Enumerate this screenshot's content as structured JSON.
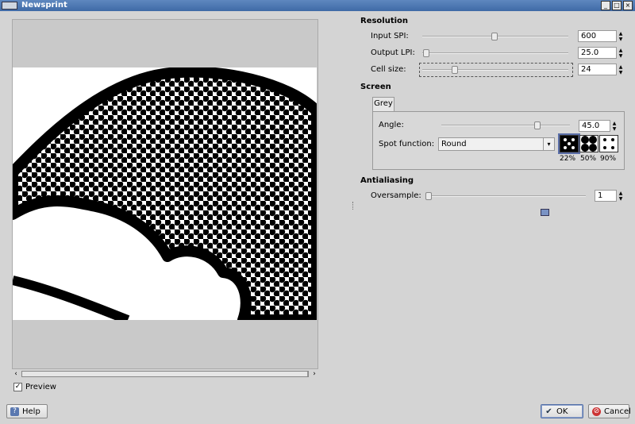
{
  "window": {
    "title": "Newsprint",
    "buttons": [
      "_",
      "□",
      "×"
    ]
  },
  "preview": {
    "checkbox_label": "Preview",
    "checked": true
  },
  "resolution": {
    "heading": "Resolution",
    "input_spi": {
      "label": "Input SPI:",
      "value": "600"
    },
    "output_lpi": {
      "label": "Output LPI:",
      "value": "25.0"
    },
    "cell_size": {
      "label": "Cell size:",
      "value": "24"
    }
  },
  "screen": {
    "heading": "Screen",
    "tab": "Grey",
    "angle": {
      "label": "Angle:",
      "value": "45.0"
    },
    "spot_function": {
      "label": "Spot function:",
      "value": "Round"
    },
    "spot_previews": [
      "22%",
      "50%",
      "90%"
    ]
  },
  "antialiasing": {
    "heading": "Antialiasing",
    "oversample": {
      "label": "Oversample:",
      "value": "1"
    }
  },
  "footer": {
    "help": "Help",
    "ok": "OK",
    "cancel": "Cancel"
  },
  "icons": {
    "help": "help-icon",
    "ok": "checkmark-icon",
    "cancel": "cancel-icon",
    "check": "✓",
    "caret": "▾"
  },
  "colors": {
    "titlebar": "#4a76b3",
    "dialog_bg": "#d4d4d4"
  }
}
